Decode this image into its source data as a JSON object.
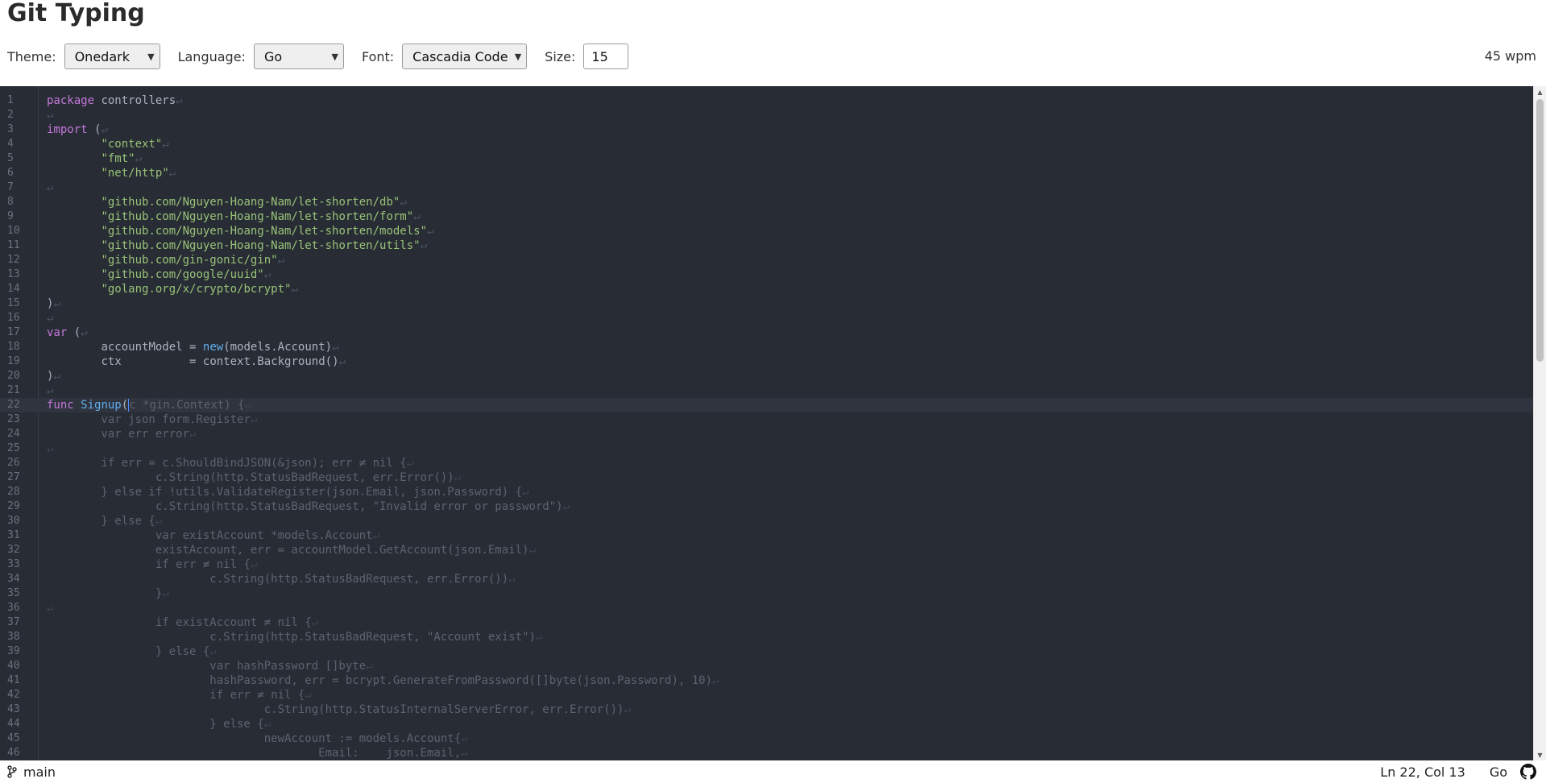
{
  "app": {
    "title": "Git Typing",
    "wpm": "45 wpm"
  },
  "toolbar": {
    "theme_label": "Theme:",
    "theme_value": "Onedark",
    "language_label": "Language:",
    "language_value": "Go",
    "font_label": "Font:",
    "font_value": "Cascadia Code",
    "size_label": "Size:",
    "size_value": "15"
  },
  "editor": {
    "active_line": 22,
    "typed_upto": {
      "line": 22,
      "col": 13
    },
    "line_numbers": [
      "1",
      "2",
      "3",
      "4",
      "5",
      "6",
      "7",
      "8",
      "9",
      "10",
      "11",
      "12",
      "13",
      "14",
      "15",
      "16",
      "17",
      "18",
      "19",
      "20",
      "21",
      "22",
      "23",
      "24",
      "25",
      "26",
      "27",
      "28",
      "29",
      "30",
      "31",
      "32",
      "33",
      "34",
      "35",
      "36",
      "37",
      "38",
      "39",
      "40",
      "41",
      "42",
      "43",
      "44",
      "45",
      "46"
    ],
    "lines": [
      "package controllers",
      "",
      "import (",
      "\t\"context\"",
      "\t\"fmt\"",
      "\t\"net/http\"",
      "",
      "\t\"github.com/Nguyen-Hoang-Nam/let-shorten/db\"",
      "\t\"github.com/Nguyen-Hoang-Nam/let-shorten/form\"",
      "\t\"github.com/Nguyen-Hoang-Nam/let-shorten/models\"",
      "\t\"github.com/Nguyen-Hoang-Nam/let-shorten/utils\"",
      "\t\"github.com/gin-gonic/gin\"",
      "\t\"github.com/google/uuid\"",
      "\t\"golang.org/x/crypto/bcrypt\"",
      ")",
      "",
      "var (",
      "\taccountModel = new(models.Account)",
      "\tctx          = context.Background()",
      ")",
      "",
      "func Signup(c *gin.Context) {",
      "\tvar json form.Register",
      "\tvar err error",
      "",
      "\tif err = c.ShouldBindJSON(&json); err ≠ nil {",
      "\t\tc.String(http.StatusBadRequest, err.Error())",
      "\t} else if !utils.ValidateRegister(json.Email, json.Password) {",
      "\t\tc.String(http.StatusBadRequest, \"Invalid error or password\")",
      "\t} else {",
      "\t\tvar existAccount *models.Account",
      "\t\texistAccount, err = accountModel.GetAccount(json.Email)",
      "\t\tif err ≠ nil {",
      "\t\t\tc.String(http.StatusBadRequest, err.Error())",
      "\t\t}",
      "",
      "\t\tif existAccount ≠ nil {",
      "\t\t\tc.String(http.StatusBadRequest, \"Account exist\")",
      "\t\t} else {",
      "\t\t\tvar hashPassword []byte",
      "\t\t\thashPassword, err = bcrypt.GenerateFromPassword([]byte(json.Password), 10)",
      "\t\t\tif err ≠ nil {",
      "\t\t\t\tc.String(http.StatusInternalServerError, err.Error())",
      "\t\t\t} else {",
      "\t\t\t\tnewAccount := models.Account{",
      "\t\t\t\t\tEmail:    json.Email,"
    ],
    "eol_glyph": "↵"
  },
  "status": {
    "branch": "main",
    "cursor": "Ln 22, Col 13",
    "language": "Go"
  },
  "icons": {
    "branch": "git-branch-icon",
    "github": "github-icon"
  }
}
